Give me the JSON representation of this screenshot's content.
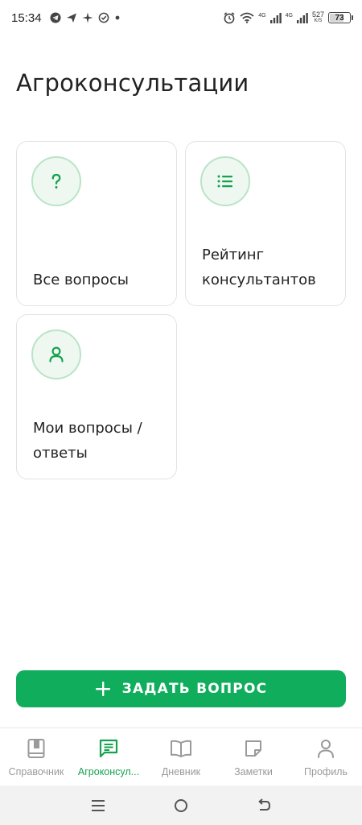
{
  "status_bar": {
    "time": "15:34",
    "network_1": "4G",
    "network_2": "4G",
    "speed_value": "527",
    "speed_unit": "K/S",
    "battery": "73",
    "battery_level": 0.73
  },
  "page": {
    "title": "Агроконсультации"
  },
  "cards": {
    "all_questions": {
      "label": "Все вопросы",
      "icon": "question-mark-icon"
    },
    "rating": {
      "label_line1": "Рейтинг",
      "label_line2": "консультантов",
      "icon": "list-icon"
    },
    "my_questions": {
      "label_line1": "Мои вопросы /",
      "label_line2": "ответы",
      "icon": "person-icon"
    }
  },
  "ask_button": {
    "label": "ЗАДАТЬ ВОПРОС",
    "icon": "plus-icon"
  },
  "bottom_nav": {
    "items": [
      {
        "label": "Справочник",
        "icon": "book-icon",
        "active": false
      },
      {
        "label": "Агроконсул...",
        "icon": "chat-icon",
        "active": true
      },
      {
        "label": "Дневник",
        "icon": "open-book-icon",
        "active": false
      },
      {
        "label": "Заметки",
        "icon": "note-icon",
        "active": false
      },
      {
        "label": "Профиль",
        "icon": "profile-icon",
        "active": false
      }
    ]
  },
  "colors": {
    "accent": "#10ad5c",
    "icon_green": "#16a24f",
    "inactive": "#9a9a9a"
  }
}
